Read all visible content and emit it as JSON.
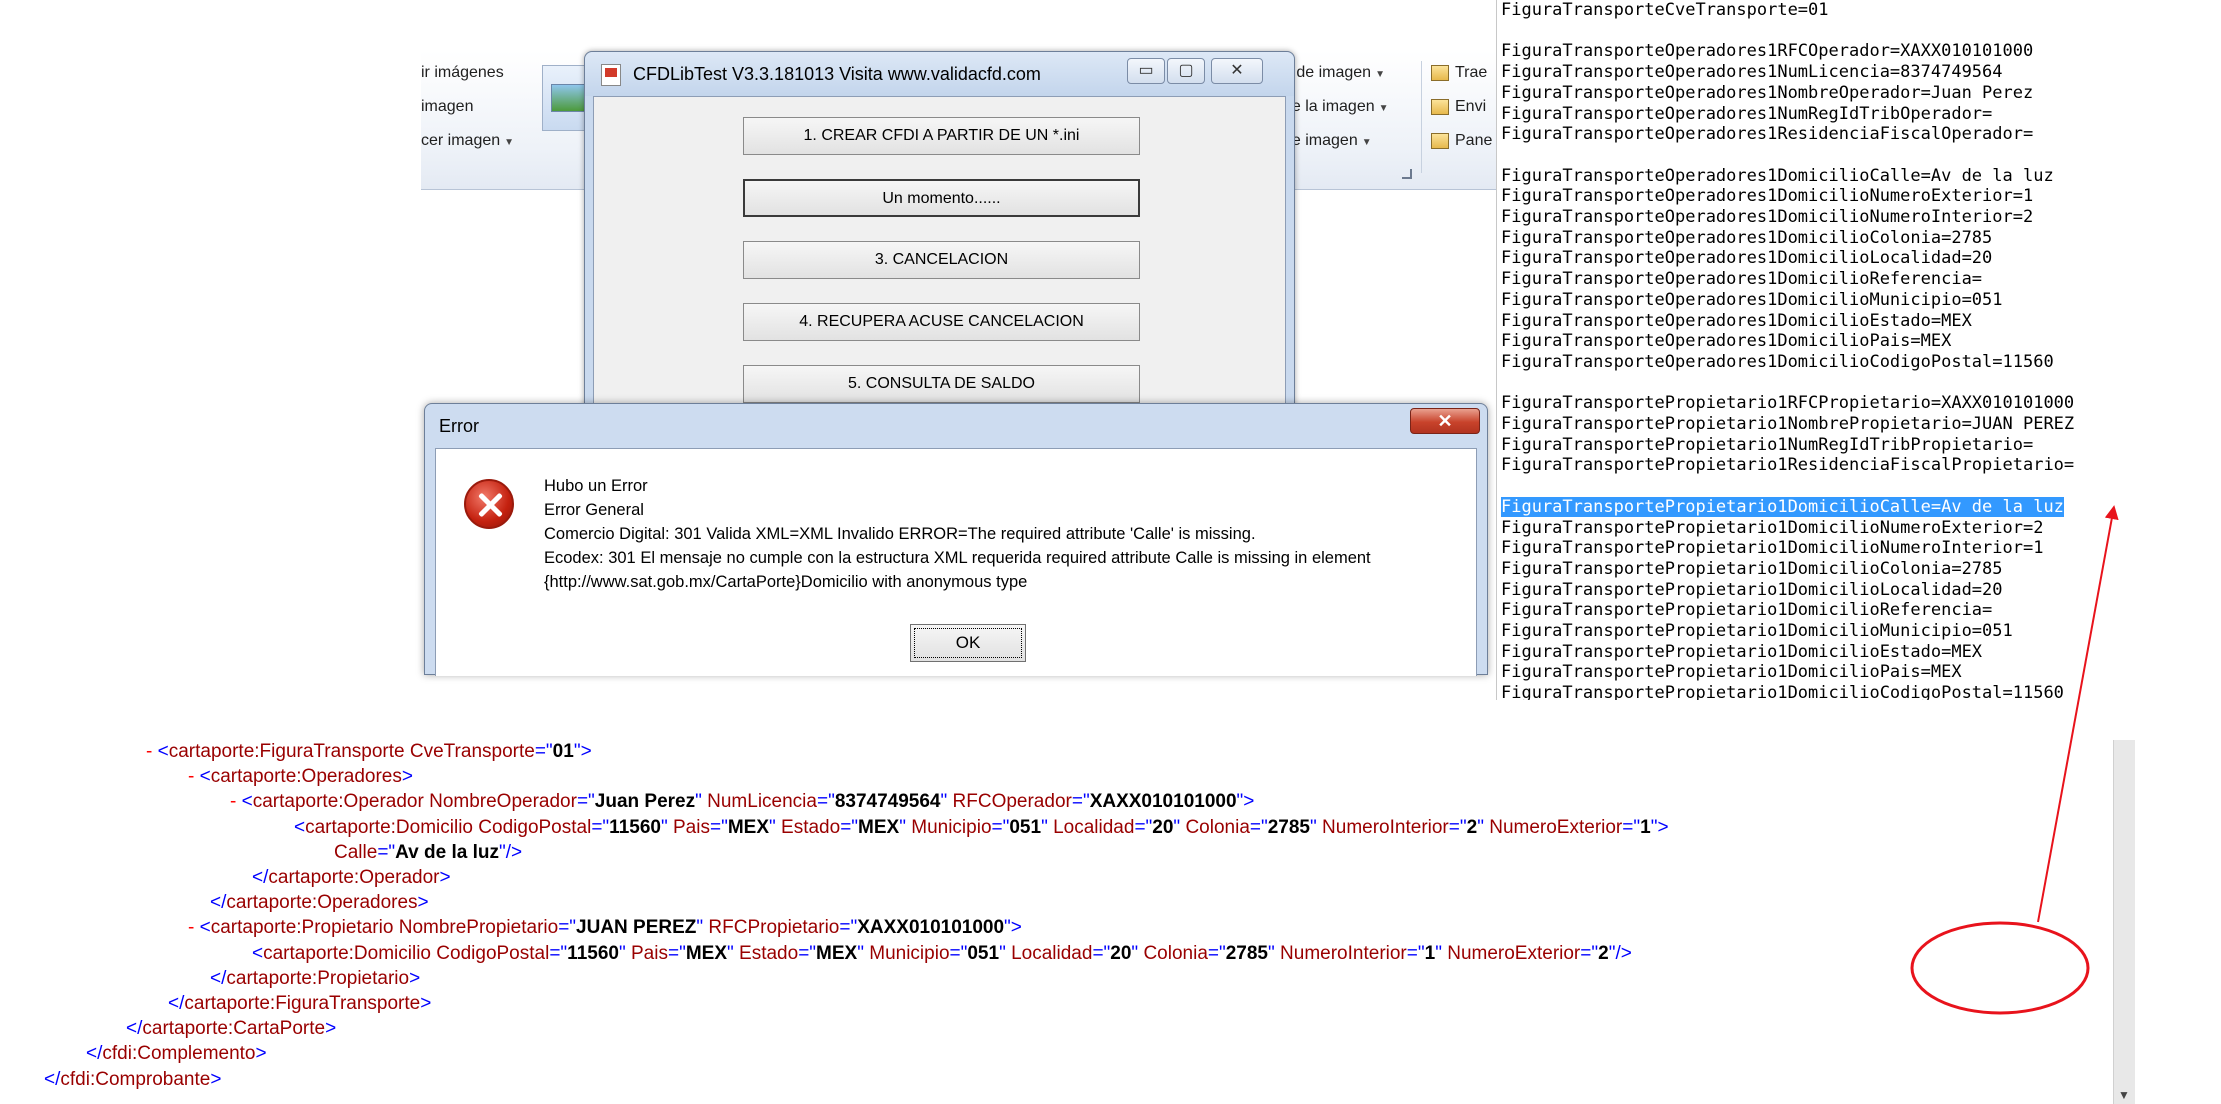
{
  "ribbon": {
    "row1_left": "ir imágenes",
    "row2_left": "imagen",
    "row3_left": "cer imagen",
    "row1_right": "o de imagen",
    "row2_right": "de la imagen",
    "row3_right": "de imagen",
    "col3_row1": "Trae",
    "col3_row2": "Envi",
    "col3_row3": "Pane"
  },
  "cfd_window": {
    "title": "CFDLibTest V3.3.181013       Visita www.validacfd.com",
    "minimize": "▭",
    "maximize": "▢",
    "close": "✕",
    "buttons": [
      "1. CREAR CFDI A PARTIR DE UN *.ini",
      "Un momento......",
      "3. CANCELACION",
      "4. RECUPERA ACUSE CANCELACION",
      "5. CONSULTA DE SALDO"
    ]
  },
  "error_dialog": {
    "title": "Error",
    "close": "✕",
    "lines": [
      "Hubo un Error",
      "Error General",
      "Comercio Digital: 301  Valida XML=XML Invalido ERROR=The required attribute 'Calle' is missing.",
      "Ecodex: 301 El mensaje no cumple con la estructura XML requerida required attribute Calle is missing in element",
      "{http://www.sat.gob.mx/CartaPorte}Domicilio with anonymous type"
    ],
    "ok_label": "OK"
  },
  "ini_lines": [
    "FiguraTransporteCveTransporte=01",
    "",
    "FiguraTransporteOperadores1RFCOperador=XAXX010101000",
    "FiguraTransporteOperadores1NumLicencia=8374749564",
    "FiguraTransporteOperadores1NombreOperador=Juan Perez",
    "FiguraTransporteOperadores1NumRegIdTribOperador=",
    "FiguraTransporteOperadores1ResidenciaFiscalOperador=",
    "",
    "FiguraTransporteOperadores1DomicilioCalle=Av de la luz",
    "FiguraTransporteOperadores1DomicilioNumeroExterior=1",
    "FiguraTransporteOperadores1DomicilioNumeroInterior=2",
    "FiguraTransporteOperadores1DomicilioColonia=2785",
    "FiguraTransporteOperadores1DomicilioLocalidad=20",
    "FiguraTransporteOperadores1DomicilioReferencia=",
    "FiguraTransporteOperadores1DomicilioMunicipio=051",
    "FiguraTransporteOperadores1DomicilioEstado=MEX",
    "FiguraTransporteOperadores1DomicilioPais=MEX",
    "FiguraTransporteOperadores1DomicilioCodigoPostal=11560",
    "",
    "FiguraTransportePropietario1RFCPropietario=XAXX010101000",
    "FiguraTransportePropietario1NombrePropietario=JUAN PEREZ",
    "FiguraTransportePropietario1NumRegIdTribPropietario=",
    "FiguraTransportePropietario1ResidenciaFiscalPropietario=",
    "",
    "FiguraTransportePropietario1DomicilioCalle=Av de la luz",
    "FiguraTransportePropietario1DomicilioNumeroExterior=2",
    "FiguraTransportePropietario1DomicilioNumeroInterior=1",
    "FiguraTransportePropietario1DomicilioColonia=2785",
    "FiguraTransportePropietario1DomicilioLocalidad=20",
    "FiguraTransportePropietario1DomicilioReferencia=",
    "FiguraTransportePropietario1DomicilioMunicipio=051",
    "FiguraTransportePropietario1DomicilioEstado=MEX",
    "FiguraTransportePropietario1DomicilioPais=MEX",
    "FiguraTransportePropietario1DomicilioCodigoPostal=11560"
  ],
  "ini_selected_index": 24,
  "xml": {
    "figura_open": {
      "minus": "-",
      "tag": "cartaporte:FiguraTransporte",
      "attrs": [
        [
          "CveTransporte",
          "01"
        ]
      ]
    },
    "operadores_open": {
      "minus": "-",
      "tag": "cartaporte:Operadores"
    },
    "operador_open": {
      "minus": "-",
      "tag": "cartaporte:Operador",
      "attrs": [
        [
          "NombreOperador",
          "Juan Perez"
        ],
        [
          "NumLicencia",
          "8374749564"
        ],
        [
          "RFCOperador",
          "XAXX010101000"
        ]
      ]
    },
    "op_domicilio": {
      "tag": "cartaporte:Domicilio",
      "attrs": [
        [
          "CodigoPostal",
          "11560"
        ],
        [
          "Pais",
          "MEX"
        ],
        [
          "Estado",
          "MEX"
        ],
        [
          "Municipio",
          "051"
        ],
        [
          "Localidad",
          "20"
        ],
        [
          "Colonia",
          "2785"
        ],
        [
          "NumeroInterior",
          "2"
        ],
        [
          "NumeroExterior",
          "1"
        ]
      ]
    },
    "op_domicilio_calle": {
      "name": "Calle",
      "value": "Av de la luz"
    },
    "operador_close": "cartaporte:Operador",
    "operadores_close": "cartaporte:Operadores",
    "propietario_open": {
      "minus": "-",
      "tag": "cartaporte:Propietario",
      "attrs": [
        [
          "NombrePropietario",
          "JUAN PEREZ"
        ],
        [
          "RFCPropietario",
          "XAXX010101000"
        ]
      ]
    },
    "prop_domicilio": {
      "tag": "cartaporte:Domicilio",
      "attrs": [
        [
          "CodigoPostal",
          "11560"
        ],
        [
          "Pais",
          "MEX"
        ],
        [
          "Estado",
          "MEX"
        ],
        [
          "Municipio",
          "051"
        ],
        [
          "Localidad",
          "20"
        ],
        [
          "Colonia",
          "2785"
        ],
        [
          "NumeroInterior",
          "1"
        ],
        [
          "NumeroExterior",
          "2"
        ]
      ]
    },
    "propietario_close": "cartaporte:Propietario",
    "figura_close": "cartaporte:FiguraTransporte",
    "cartaporte_close": "cartaporte:CartaPorte",
    "complemento_close": "cfdi:Complemento",
    "comprobante_close": "cfdi:Comprobante"
  },
  "colors": {
    "annotation": "#e8131c",
    "selection": "#3399ff",
    "xml_tag": "#0000ff",
    "xml_name": "#990000"
  }
}
